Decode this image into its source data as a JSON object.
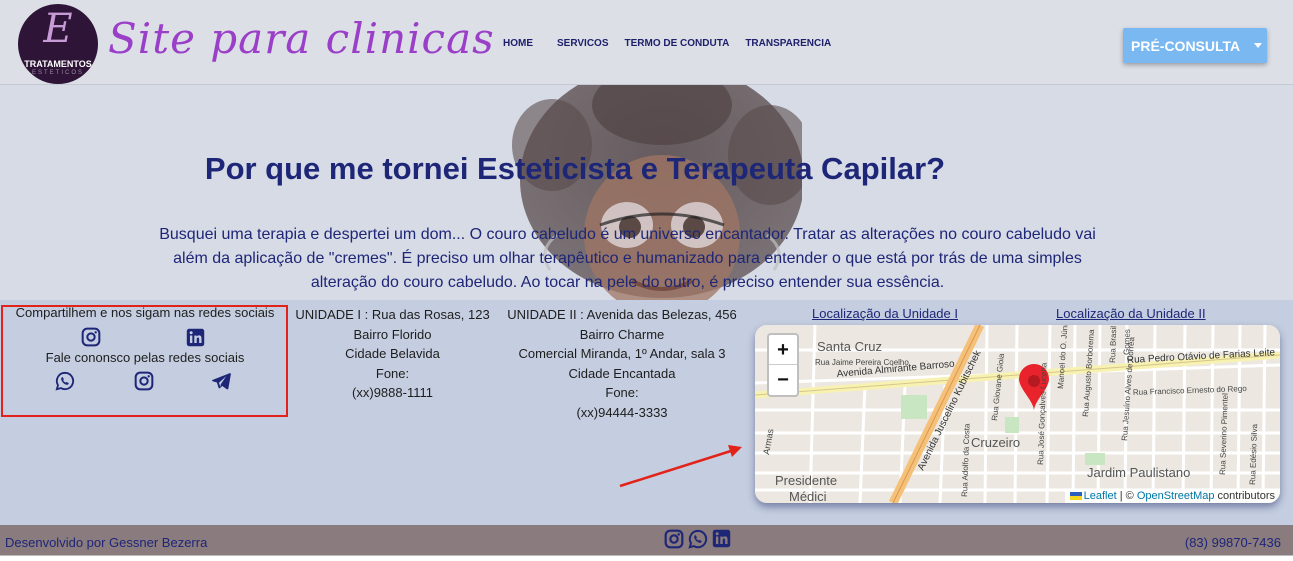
{
  "header": {
    "logo_letter": "E",
    "logo_text": "TRATAMENTOS",
    "logo_sub": "ESTETICOS",
    "brand": "Site para clinicas",
    "nav": [
      "HOME",
      "SERVICOS",
      "TERMO DE CONDUTA",
      "TRANSPARENCIA"
    ],
    "cta_label": "PRÉ-CONSULTA"
  },
  "hero": {
    "title": "Por que me tornei Esteticista e Terapeuta Capilar?",
    "text": "Busquei uma terapia e despertei um dom... O couro cabeludo é um universo encantador. Tratar as alterações no couro cabeludo vai além da aplicação de \"cremes\". É preciso um olhar terapêutico e humanizado para entender o que está por trás de uma simples alteração do couro cabeludo. Ao tocar na pele do outro, é preciso entender sua essência."
  },
  "social": {
    "title": "Compartilhem e nos sigam nas redes sociais",
    "contact_title": "Fale cononsco pelas redes sociais"
  },
  "units": {
    "unit1": {
      "lines": [
        "UNIDADE I : Rua das Rosas, 123",
        "Bairro Florido",
        "Cidade Belavida",
        "Fone:",
        "(xx)9888-1111"
      ]
    },
    "unit2": {
      "lines": [
        "UNIDADE II : Avenida das Belezas, 456",
        "Bairro Charme",
        "Comercial Miranda, 1º Andar, sala 3",
        "Cidade Encantada",
        "Fone:",
        "(xx)94444-3333"
      ]
    }
  },
  "map": {
    "link1": "Localização da Unidade I",
    "link2": "Localização da Unidade II",
    "zoom_in": "+",
    "zoom_out": "−",
    "attrib_leaflet": "Leaflet",
    "attrib_sep": " | © ",
    "attrib_osm": "OpenStreetMap",
    "attrib_tail": " contributors",
    "labels": {
      "santa_cruz": "Santa Cruz",
      "jaime": "Rua Jaime Pereira Coelho",
      "almirante": "Avenida Almirante Barroso",
      "pedro": "Rua Pedro Otávio de Farias Leite",
      "juscelino": "Avenida Juscelino Kubitschek",
      "cruzeiro": "Cruzeiro",
      "jardim": "Jardim Paulistano",
      "presidente": "Presidente",
      "medici": "Médici",
      "francisco": "Rua Francisco Ernesto do Rego",
      "adolfo": "Rua Adolfo da Costa",
      "jose": "Rua José Gonçalves Lucena",
      "giovane": "Rua Giovane Gioia",
      "manoel": "Manoel do O. Júnior",
      "augusto": "Rua Augusto Borborema",
      "alves": "Rua Jesuíno Alves de Corrêa",
      "gomes": "Gomes",
      "brasil": "Rua Brasil",
      "severino": "Rua Severino Pimentel",
      "edesio": "Rua Edésio Silva",
      "armas": "Armas"
    }
  },
  "footer": {
    "dev": "Desenvolvido por Gessner Bezerra",
    "phone": "(83) 99870-7436"
  },
  "colors": {
    "navy": "#1e2677",
    "brand_purple": "#9a3fc8",
    "cta_blue": "#7ab8f2",
    "highlight_red": "#e2231a",
    "footer_bg": "#8a7b7e",
    "marker_red": "#e8232b"
  },
  "icons": [
    "instagram-icon",
    "linkedin-icon",
    "whatsapp-icon",
    "telegram-icon"
  ]
}
